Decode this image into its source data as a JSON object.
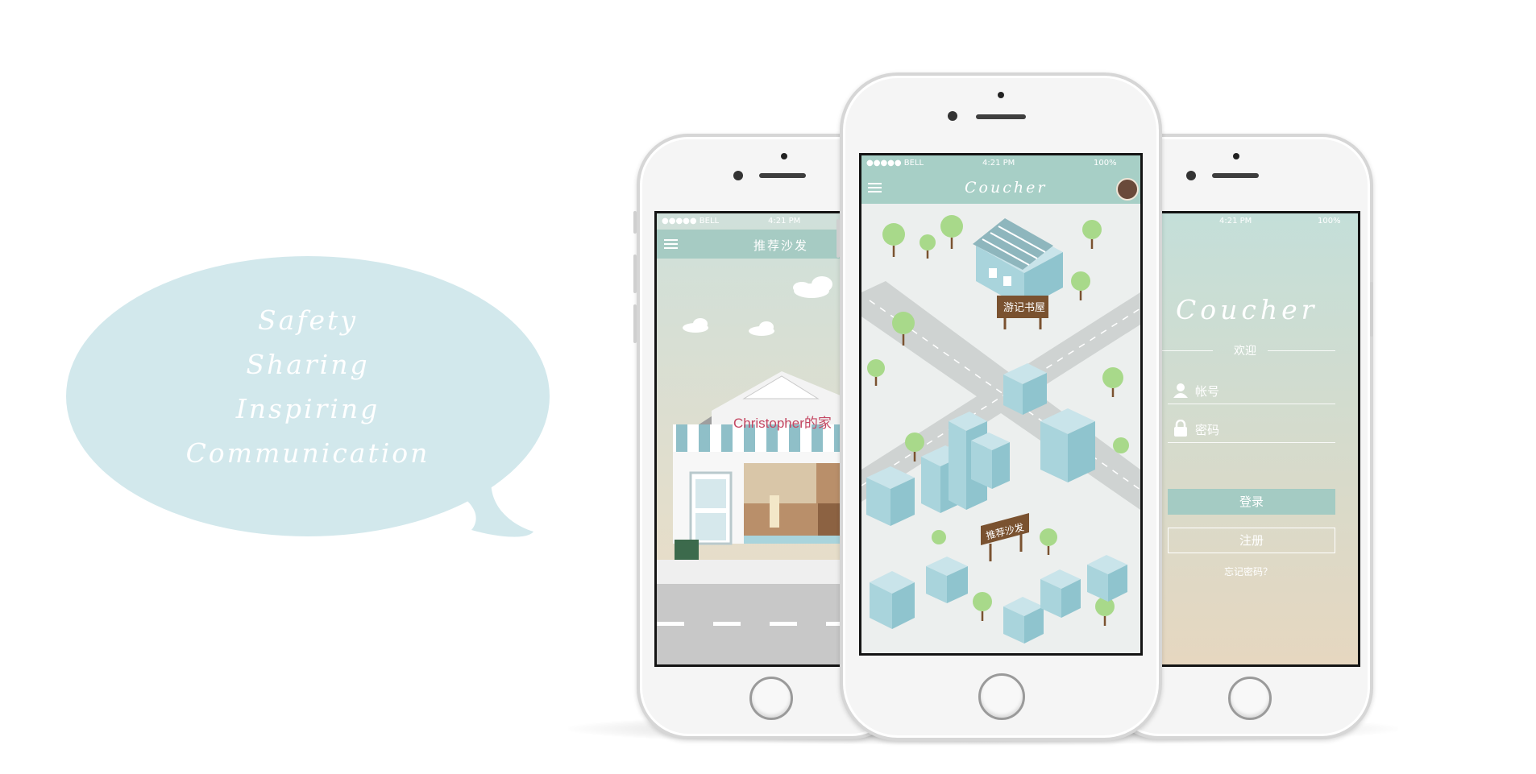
{
  "bubble": {
    "lines": [
      "Safety",
      "Sharing",
      "Inspiring",
      "Communication"
    ],
    "color": "#d2e8ec"
  },
  "left_phone": {
    "status": {
      "carrier": "●●●●● BELL",
      "time": "4:21 PM"
    },
    "nav_title": "推荐沙发",
    "house_sign": "Christopher的家"
  },
  "center_phone": {
    "status": {
      "carrier": "●●●●● BELL",
      "time": "4:21 PM",
      "battery": "100%"
    },
    "app_title": "Coucher",
    "sign_bookstore": "游记书屋",
    "sign_sofa": "推荐沙发"
  },
  "right_phone": {
    "status": {
      "time": "4:21 PM",
      "battery": "100%"
    },
    "app_title": "Coucher",
    "welcome": "欢迎",
    "account_placeholder": "帐号",
    "password_placeholder": "密码",
    "login_label": "登录",
    "register_label": "注册",
    "forgot_label": "忘记密码？"
  },
  "colors": {
    "nav": "#a7cfc6",
    "map_bg": "#e9eeec",
    "road": "#cfd3d2",
    "building": "#a9d4dc",
    "tree": "#a8d98a",
    "sign": "#7a5230"
  }
}
